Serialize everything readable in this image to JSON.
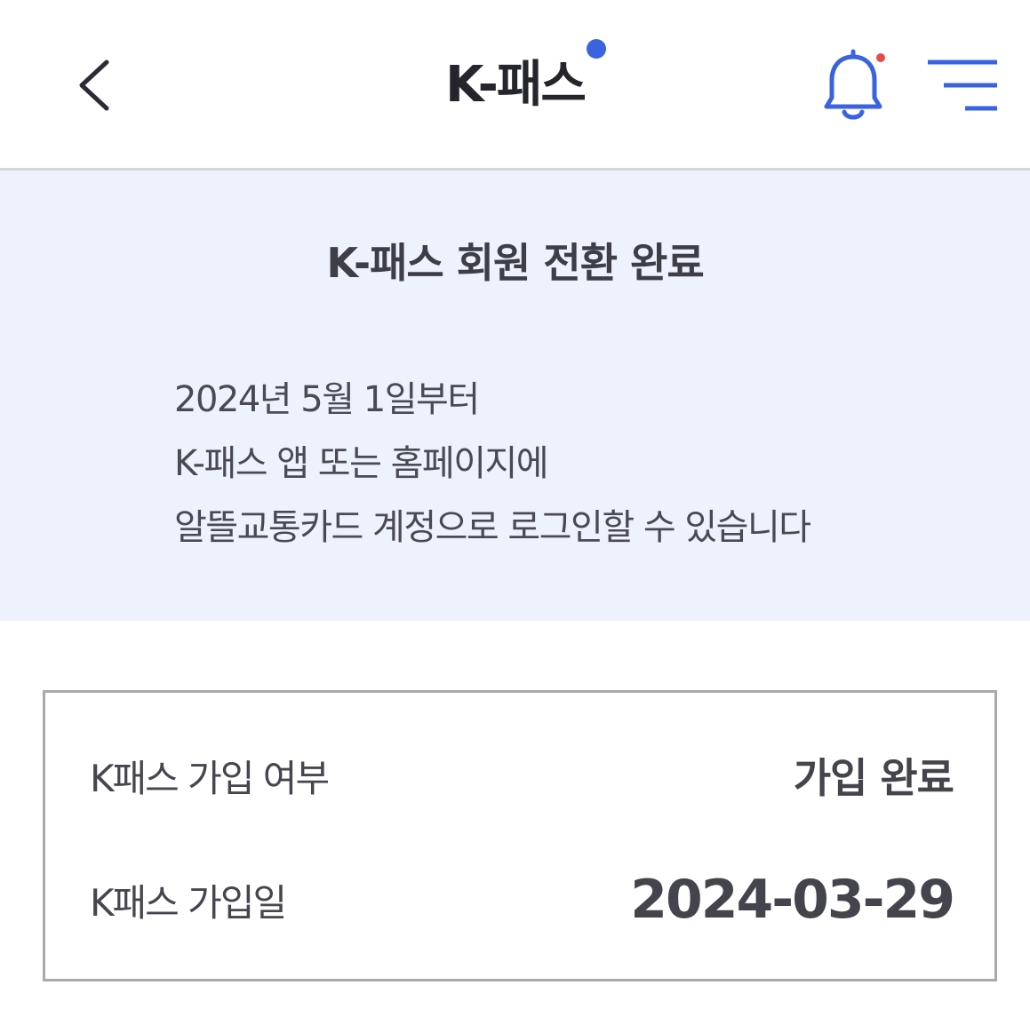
{
  "header": {
    "title": "K-패스",
    "back_icon": "chevron-left-icon",
    "notification_icon": "bell-icon",
    "menu_icon": "menu-icon",
    "accent_color": "#3a63e0",
    "notification_dot_color": "#e8494a"
  },
  "banner": {
    "title": "K-패스 회원 전환 완료",
    "lines": [
      "2024년 5월 1일부터",
      "K-패스 앱 또는 홈페이지에",
      "알뜰교통카드 계정으로 로그인할 수 있습니다"
    ]
  },
  "info": {
    "rows": [
      {
        "label": "K패스 가입 여부",
        "value": "가입 완료"
      },
      {
        "label": "K패스 가입일",
        "value": "2024-03-29"
      }
    ]
  }
}
